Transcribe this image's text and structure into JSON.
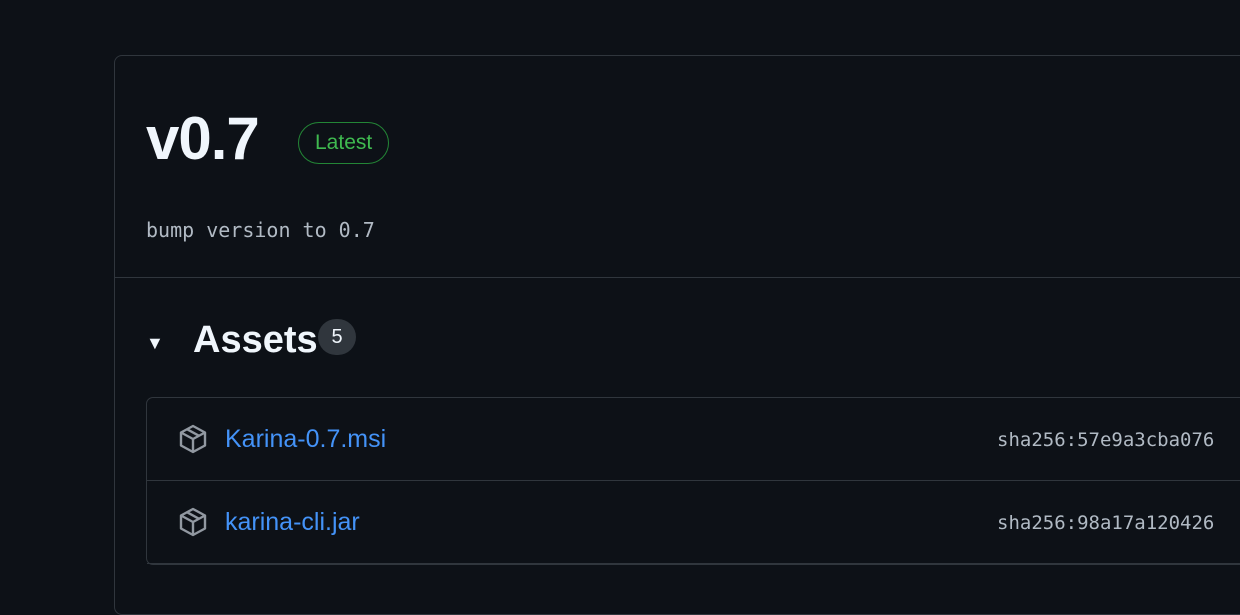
{
  "release": {
    "version": "v0.7",
    "badge": "Latest",
    "commit_message": "bump version to 0.7"
  },
  "assets": {
    "title": "Assets",
    "count": "5",
    "items": [
      {
        "name": "Karina-0.7.msi",
        "sha": "sha256:57e9a3cba076",
        "icon": "package-icon"
      },
      {
        "name": "karina-cli.jar",
        "sha": "sha256:98a17a120426",
        "icon": "package-icon"
      }
    ]
  },
  "colors": {
    "background": "#0d1117",
    "border": "#30363d",
    "link": "#4493f8",
    "latest_green": "#3fb950"
  }
}
